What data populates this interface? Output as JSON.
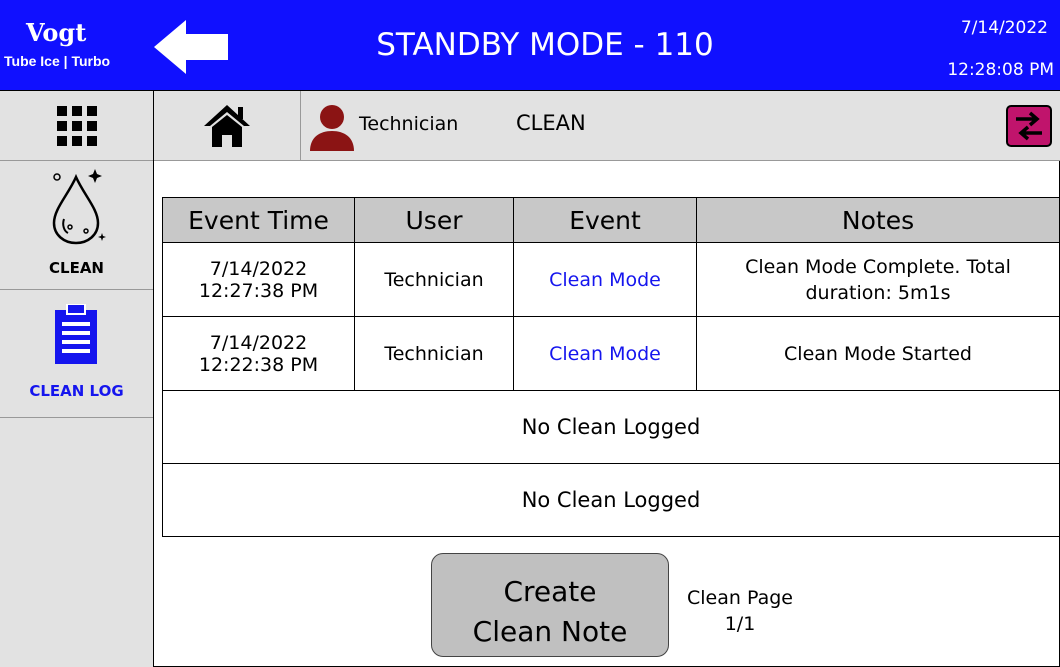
{
  "header": {
    "brand": "Vogt",
    "brand_sub": "Tube Ice | Turbo",
    "title": "STANDBY MODE - 110",
    "date": "7/14/2022",
    "time": "12:28:08 PM",
    "bg_color": "#1010ff"
  },
  "sidebar": {
    "menu_icon": "grid-menu-icon",
    "items": [
      {
        "label": "CLEAN",
        "icon": "clean-drop-icon",
        "color": "#000000"
      },
      {
        "label": "CLEAN LOG",
        "icon": "clipboard-icon",
        "color": "#1515ee"
      }
    ]
  },
  "navbar": {
    "home_icon": "home-icon",
    "user_icon": "user-icon",
    "user_name": "Technician",
    "screen_name": "CLEAN",
    "switch_icon": "switch-icon"
  },
  "table": {
    "headers": [
      "Event Time",
      "User",
      "Event",
      "Notes"
    ],
    "rows": [
      {
        "date": "7/14/2022",
        "time": "12:27:38 PM",
        "user": "Technician",
        "event": "Clean Mode",
        "notes": "Clean Mode Complete. Total duration: 5m1s"
      },
      {
        "date": "7/14/2022",
        "time": "12:22:38 PM",
        "user": "Technician",
        "event": "Clean Mode",
        "notes": "Clean Mode Started"
      }
    ],
    "empty_rows": [
      "No Clean Logged",
      "No Clean Logged"
    ]
  },
  "footer": {
    "create_button": "Create Clean Note",
    "page_label": "Clean Page",
    "page_value": "1/1"
  }
}
